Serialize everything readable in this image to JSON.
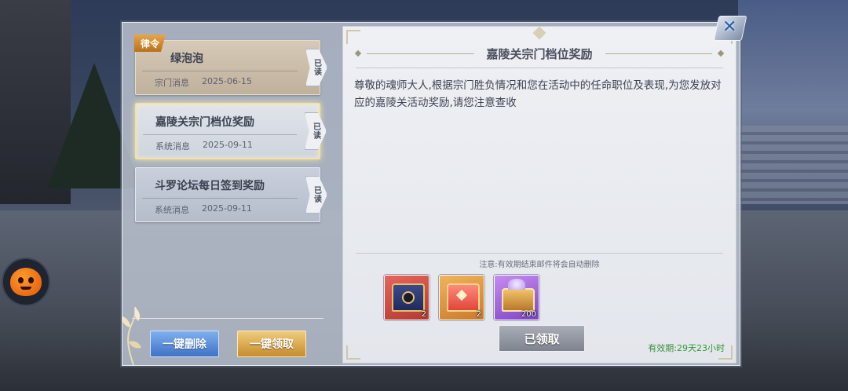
{
  "mail_list": [
    {
      "tag": "律令",
      "title": "绿泡泡",
      "category": "宗门消息",
      "date": "2025-06-15",
      "status": "已读"
    },
    {
      "title": "嘉陵关宗门档位奖励",
      "category": "系统消息",
      "date": "2025-09-11",
      "status": "已读"
    },
    {
      "title": "斗罗论坛每日签到奖励",
      "category": "系统消息",
      "date": "2025-09-11",
      "status": "已读"
    }
  ],
  "buttons": {
    "delete_all": "一键删除",
    "claim_all": "一键领取",
    "claimed": "已领取"
  },
  "detail": {
    "title": "嘉陵关宗门档位奖励",
    "body": "尊敬的魂师大人,根据宗门胜负情况和您在活动中的任命职位及表现,为您发放对应的嘉陵关活动奖励,请您注意查收",
    "note": "注意:有效期结束邮件将会自动删除",
    "rewards": [
      {
        "icon": "dark-chest-icon",
        "quantity": "2"
      },
      {
        "icon": "red-chest-icon",
        "quantity": "2"
      },
      {
        "icon": "crystal-chest-icon",
        "quantity": "200"
      }
    ],
    "validity_label": "有效期:",
    "validity_value": "29天23小时"
  },
  "colors": {
    "delete_button": "#3f72c6",
    "claim_all_button": "#c68c2e",
    "validity_text": "#2f9a36"
  }
}
